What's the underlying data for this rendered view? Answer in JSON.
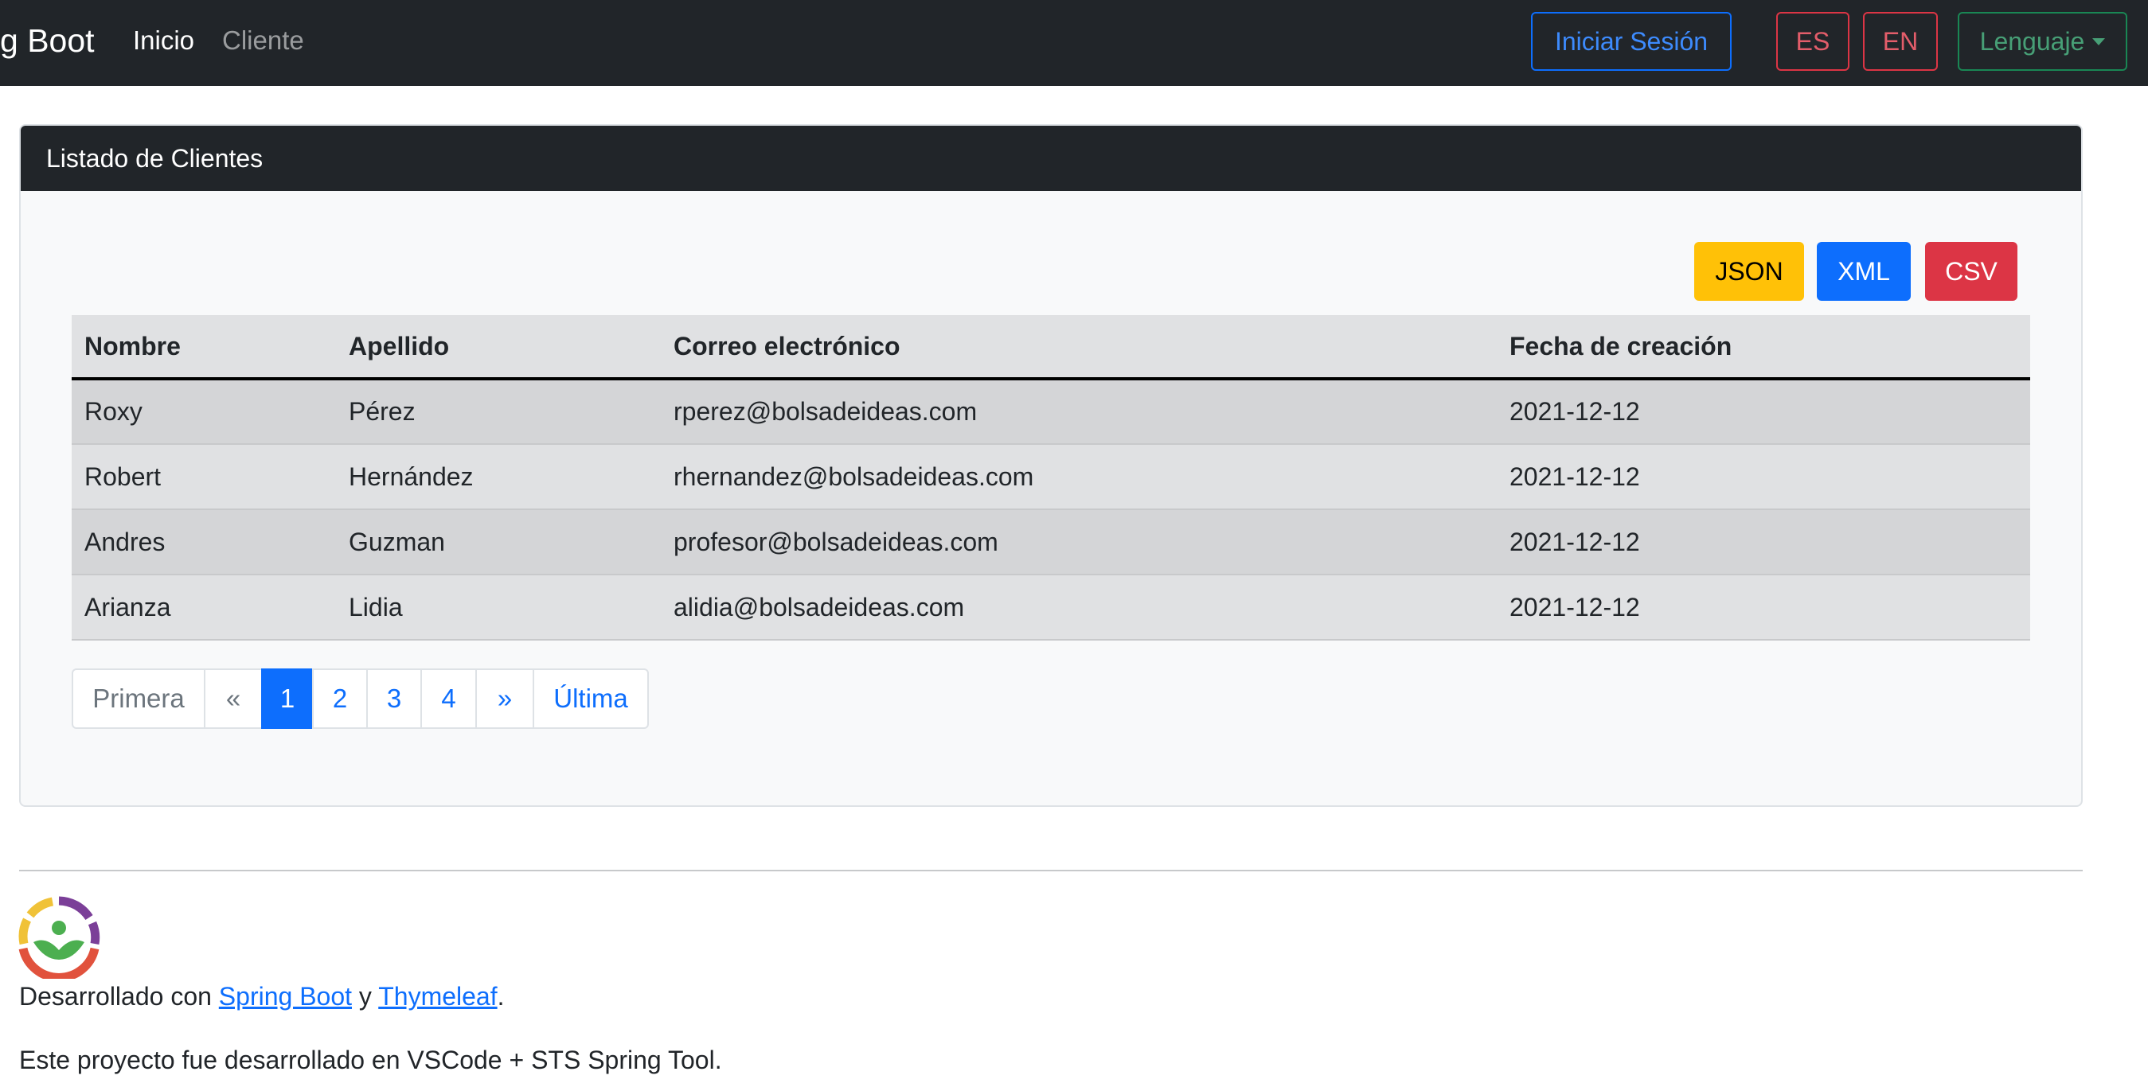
{
  "navbar": {
    "brand": "g Boot",
    "links": [
      {
        "label": "Inicio",
        "active": true
      },
      {
        "label": "Cliente",
        "active": false
      }
    ],
    "login_label": "Iniciar Sesión",
    "lang_es": "ES",
    "lang_en": "EN",
    "lang_dropdown": "Lenguaje"
  },
  "card": {
    "header": "Listado de Clientes",
    "export_buttons": {
      "json": "JSON",
      "xml": "XML",
      "csv": "CSV"
    },
    "table": {
      "headers": [
        "Nombre",
        "Apellido",
        "Correo electrónico",
        "Fecha de creación"
      ],
      "rows": [
        [
          "Roxy",
          "Pérez",
          "rperez@bolsadeideas.com",
          "2021-12-12"
        ],
        [
          "Robert",
          "Hernández",
          "rhernandez@bolsadeideas.com",
          "2021-12-12"
        ],
        [
          "Andres",
          "Guzman",
          "profesor@bolsadeideas.com",
          "2021-12-12"
        ],
        [
          "Arianza",
          "Lidia",
          "alidia@bolsadeideas.com",
          "2021-12-12"
        ]
      ]
    },
    "pagination": {
      "first": "Primera",
      "prev": "«",
      "pages": [
        "1",
        "2",
        "3",
        "4"
      ],
      "current": "1",
      "next": "»",
      "last": "Última"
    }
  },
  "footer": {
    "developed_prefix": "Desarrollado con ",
    "spring_link": "Spring Boot",
    "connector": " y ",
    "thymeleaf_link": "Thymeleaf",
    "period": ".",
    "note": "Este proyecto fue desarrollado en VSCode + STS Spring Tool."
  },
  "colors": {
    "navbar_bg": "#212529",
    "primary": "#0d6efd",
    "danger": "#dc3545",
    "warning": "#ffc107",
    "success": "#198754"
  }
}
